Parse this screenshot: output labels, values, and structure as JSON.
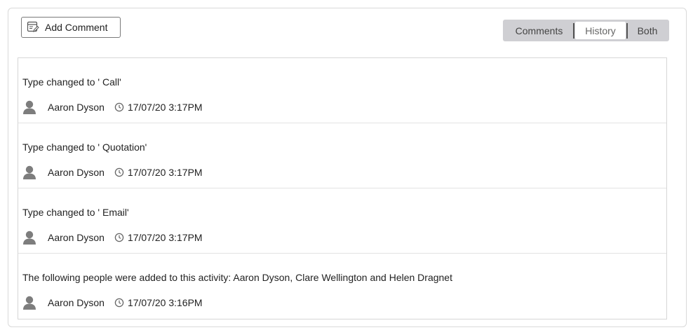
{
  "toolbar": {
    "add_comment_label": "Add Comment"
  },
  "view_toggle": {
    "options": [
      "Comments",
      "History",
      "Both"
    ],
    "selected": "History"
  },
  "history": {
    "items": [
      {
        "message": "Type changed to ' Call'",
        "author": "Aaron Dyson",
        "timestamp": "17/07/20 3:17PM"
      },
      {
        "message": "Type changed to ' Quotation'",
        "author": "Aaron Dyson",
        "timestamp": "17/07/20 3:17PM"
      },
      {
        "message": "Type changed to ' Email'",
        "author": "Aaron Dyson",
        "timestamp": "17/07/20 3:17PM"
      },
      {
        "message": "The following people were added to this activity: Aaron Dyson, Clare Wellington and Helen Dragnet",
        "author": "Aaron Dyson",
        "timestamp": "17/07/20 3:16PM"
      }
    ]
  },
  "icons": {
    "add_comment": "comment-edit-icon",
    "user": "user-avatar-icon",
    "time": "clock-icon"
  },
  "colors": {
    "toggle_bg": "#cfcfd3",
    "toggle_selected_bg": "#ffffff",
    "avatar_gray": "#7d7d7d"
  }
}
